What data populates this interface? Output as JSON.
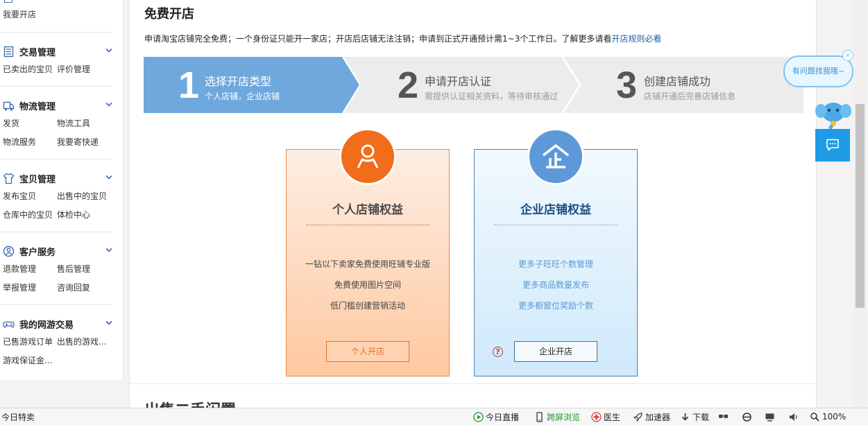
{
  "sidebar": {
    "top_link": "我要开店",
    "sections": [
      {
        "title": "交易管理",
        "icon": "document-list-icon",
        "links": [
          "已卖出的宝贝",
          "评价管理"
        ]
      },
      {
        "title": "物流管理",
        "icon": "truck-icon",
        "links": [
          "发货",
          "物流工具",
          "物流服务",
          "我要寄快递"
        ]
      },
      {
        "title": "宝贝管理",
        "icon": "tshirt-icon",
        "links": [
          "发布宝贝",
          "出售中的宝贝",
          "仓库中的宝贝",
          "体检中心"
        ]
      },
      {
        "title": "客户服务",
        "icon": "customer-service-icon",
        "links": [
          "退款管理",
          "售后管理",
          "举报管理",
          "咨询回复"
        ]
      },
      {
        "title": "我的网游交易",
        "icon": "gamepad-icon",
        "links": [
          "已售游戏订单",
          "出售的游戏...",
          "游戏保证金..."
        ]
      }
    ]
  },
  "main": {
    "title": "免费开店",
    "notice": "申请淘宝店铺完全免费；一个身份证只能开一家店；开店后店铺无法注销；申请到正式开通预计需1~3个工作日。了解更多请看",
    "notice_link": "开店规则必看",
    "steps": [
      {
        "num": "1",
        "label": "选择开店类型",
        "sub": "个人店铺，企业店铺"
      },
      {
        "num": "2",
        "label": "申请开店认证",
        "sub": "需提供认证相关资料，等待审核通过"
      },
      {
        "num": "3",
        "label": "创建店铺成功",
        "sub": "店铺开通后完善店铺信息"
      }
    ],
    "personal": {
      "title": "个人店铺权益",
      "features": [
        "一钻以下卖家免费使用旺铺专业版",
        "免费使用图片空间",
        "低门槛创建营销活动"
      ],
      "button": "个人开店"
    },
    "enterprise": {
      "title": "企业店铺权益",
      "features": [
        "更多子旺旺个数管理",
        "更多商品数量发布",
        "更多橱窗位奖励个数"
      ],
      "button": "企业开店"
    },
    "next_section_title": "出售二手闲置"
  },
  "widgets": {
    "help_bubble": "有问题找我哦~"
  },
  "statusbar": {
    "left": "今日特卖",
    "live": "今日直播",
    "cross_screen": "跨屏浏览",
    "doctor": "医生",
    "accelerator": "加速器",
    "download": "下载",
    "zoom": "100%"
  },
  "colors": {
    "step_active": "#6fa8dc",
    "personal_accent": "#f06d1b",
    "enterprise_accent": "#5d99d8",
    "link": "#1d5fa8",
    "chat_button": "#1e9be6"
  }
}
